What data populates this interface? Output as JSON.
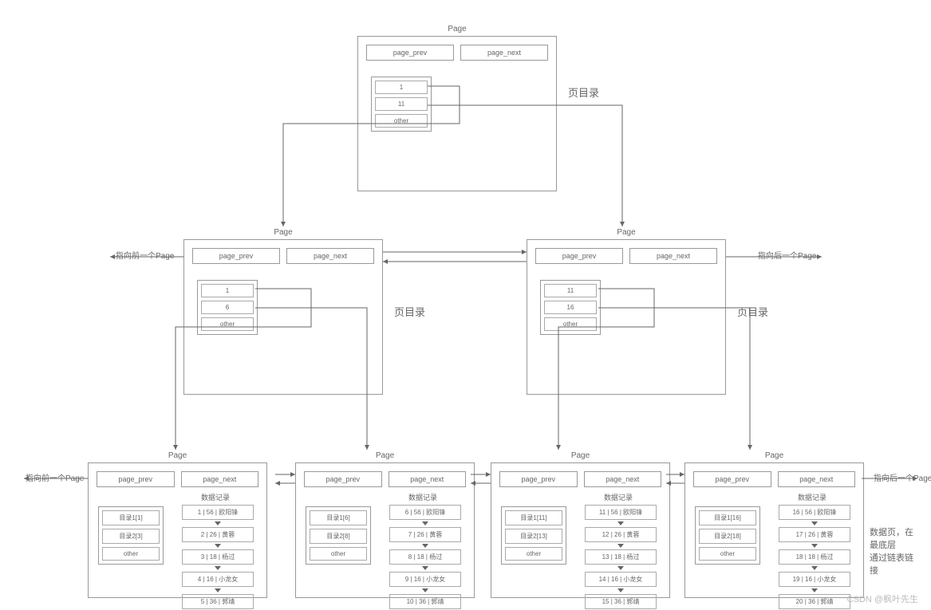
{
  "labels": {
    "page": "Page",
    "page_prev": "page_prev",
    "page_next": "page_next",
    "other": "other",
    "dir_label": "页目录",
    "records_label": "数据记录",
    "prev_page_ptr": "指向前一个Page",
    "next_page_ptr": "指向后一个Page",
    "data_page_note_1": "数据页，在",
    "data_page_note_2": "最底层",
    "data_page_note_3": "通过链表链",
    "data_page_note_4": "接",
    "watermark": "CSDN @枫叶先生"
  },
  "root": {
    "entries": [
      "1",
      "11",
      "other"
    ]
  },
  "mid": [
    {
      "entries": [
        "1",
        "6",
        "other"
      ]
    },
    {
      "entries": [
        "11",
        "16",
        "other"
      ]
    }
  ],
  "leaf": [
    {
      "dir": [
        "目录1[1]",
        "目录2[3]",
        "other"
      ],
      "records": [
        "1 | 56 | 欧阳锋",
        "2 | 26 | 黄蓉",
        "3 | 18 | 杨过",
        "4 | 16 | 小龙女",
        "5 | 36 | 郭靖"
      ]
    },
    {
      "dir": [
        "目录1[6]",
        "目录2[8]",
        "other"
      ],
      "records": [
        "6 | 56 | 欧阳锋",
        "7 | 26 | 黄蓉",
        "8 | 18 | 杨过",
        "9 | 16 | 小龙女",
        "10 | 36 | 郭靖"
      ]
    },
    {
      "dir": [
        "目录1[11]",
        "目录2[13]",
        "other"
      ],
      "records": [
        "11 | 56 | 欧阳锋",
        "12 | 26 | 黄蓉",
        "13 | 18 | 杨过",
        "14 | 16 | 小龙女",
        "15 | 36 | 郭靖"
      ]
    },
    {
      "dir": [
        "目录1[16]",
        "目录2[18]",
        "other"
      ],
      "records": [
        "16 | 56 | 欧阳锋",
        "17 | 26 | 黄蓉",
        "18 | 18 | 杨过",
        "19 | 16 | 小龙女",
        "20 | 36 | 郭靖"
      ]
    }
  ]
}
